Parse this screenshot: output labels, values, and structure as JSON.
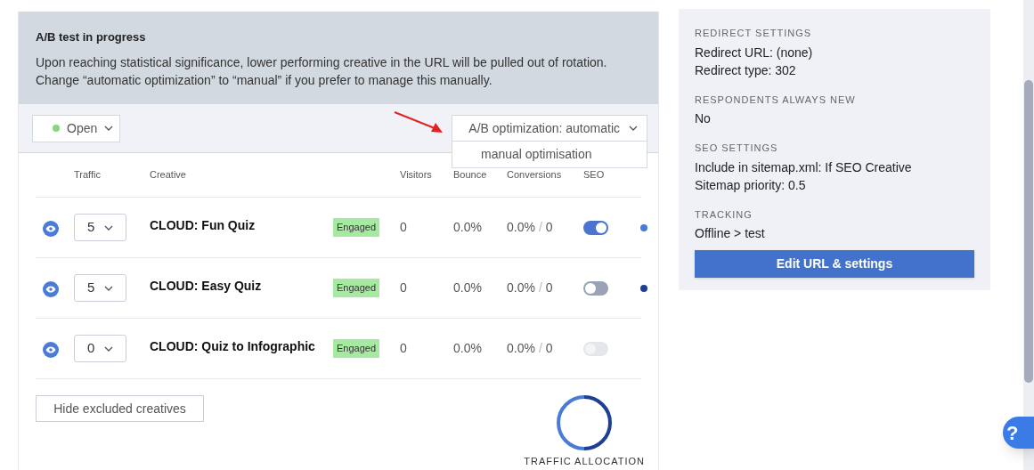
{
  "banner": {
    "title": "A/B test in progress",
    "text": "Upon reaching statistical significance, lower performing creative in the URL will be pulled out of rotation. Change “automatic optimization” to “manual” if you prefer to manage this manually."
  },
  "status_select": {
    "value": "Open",
    "color": "#86d67e"
  },
  "optimization_select": {
    "value": "A/B optimization: automatic",
    "expanded": true,
    "options": [
      "manual optimisation"
    ]
  },
  "table": {
    "columns": [
      "Traffic",
      "Creative",
      "Visitors",
      "Bounce",
      "Conversions",
      "SEO"
    ],
    "rows": [
      {
        "traffic": "5",
        "creative": "CLOUD: Fun Quiz",
        "badge": "Engaged",
        "visitors": "0",
        "bounce": "0.0%",
        "conversions": "0.0%",
        "separator": "/",
        "conversions_count": "0",
        "seo_on": true,
        "seo_disabled": false,
        "color": "#4a7bd6"
      },
      {
        "traffic": "5",
        "creative": "CLOUD: Easy Quiz",
        "badge": "Engaged",
        "visitors": "0",
        "bounce": "0.0%",
        "conversions": "0.0%",
        "separator": "/",
        "conversions_count": "0",
        "seo_on": false,
        "seo_disabled": false,
        "color": "#1d3f94"
      },
      {
        "traffic": "0",
        "creative": "CLOUD: Quiz to Infographic",
        "badge": "Engaged",
        "visitors": "0",
        "bounce": "0.0%",
        "conversions": "0.0%",
        "separator": "/",
        "conversions_count": "0",
        "seo_on": false,
        "seo_disabled": true
      }
    ]
  },
  "hide_button": "Hide excluded creatives",
  "traffic_allocation": {
    "label": "TRAFFIC ALLOCATION"
  },
  "settings": {
    "sections": [
      {
        "heading": "REDIRECT SETTINGS",
        "lines": [
          "Redirect URL: (none)",
          "Redirect type: 302"
        ]
      },
      {
        "heading": "RESPONDENTS ALWAYS NEW",
        "lines": [
          "No"
        ]
      },
      {
        "heading": "SEO SETTINGS",
        "lines": [
          "Include in sitemap.xml: If SEO Creative",
          "Sitemap priority: 0.5"
        ]
      },
      {
        "heading": "TRACKING",
        "lines": [
          "Offline > test"
        ]
      }
    ],
    "button": "Edit URL & settings"
  },
  "help_button": "?"
}
